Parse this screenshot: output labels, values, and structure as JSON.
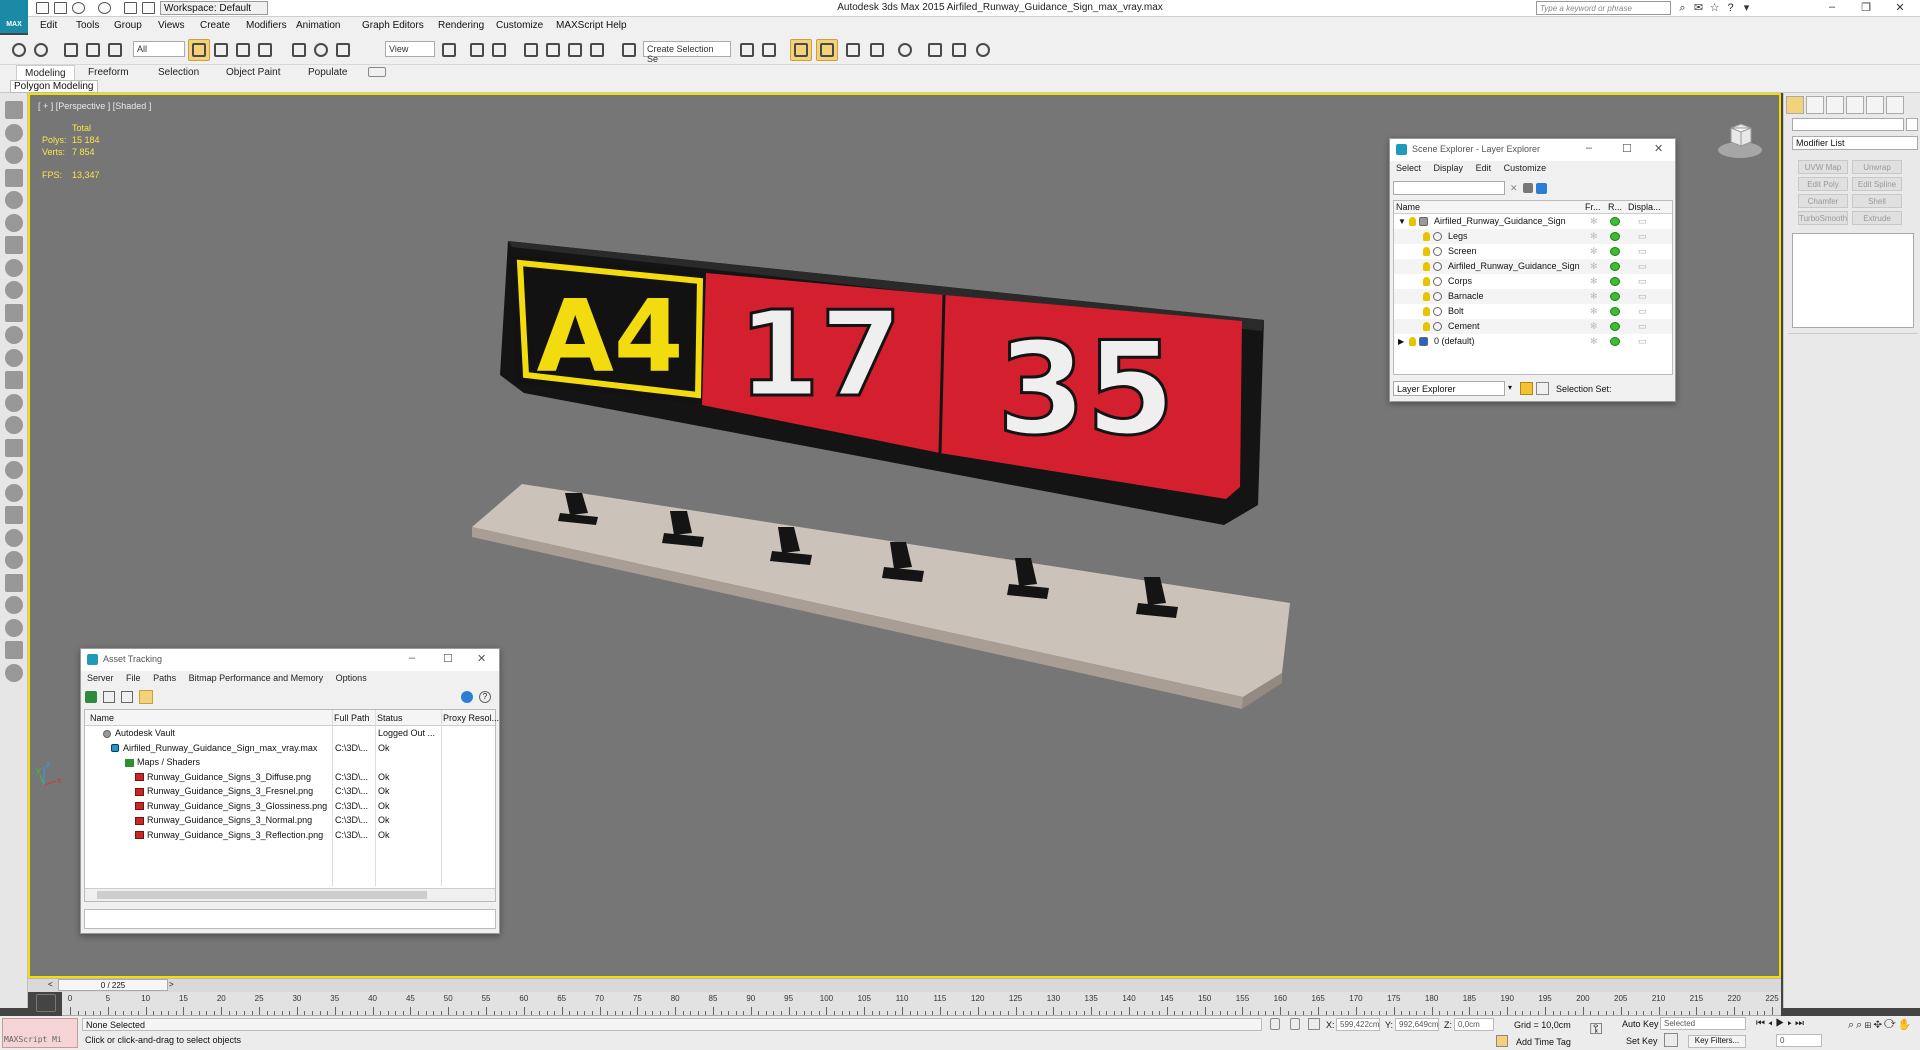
{
  "app": {
    "title": "Autodesk 3ds Max  2015     Airfiled_Runway_Guidance_Sign_max_vray.max",
    "logo_text": "MAX",
    "workspace": "Workspace: Default",
    "search_placeholder": "Type a keyword or phrase"
  },
  "menus": [
    "Edit",
    "Tools",
    "Group",
    "Views",
    "Create",
    "Modifiers",
    "Animation",
    "Graph Editors",
    "Rendering",
    "Customize",
    "MAXScript",
    "Help"
  ],
  "toolbar": {
    "selection_filter": "All",
    "ref_coord": "View",
    "named_selection_placeholder": "Create Selection Se"
  },
  "ribbon": {
    "tabs": [
      "Modeling",
      "Freeform",
      "Selection",
      "Object Paint",
      "Populate"
    ],
    "active_tab": "Modeling",
    "panel_label": "Polygon Modeling"
  },
  "viewport": {
    "label": "[ + ] [Perspective ] [Shaded ]",
    "stats": {
      "total_label": "Total",
      "polys_label": "Polys:",
      "polys_value": "15 184",
      "verts_label": "Verts:",
      "verts_value": "7 854",
      "fps_label": "FPS:",
      "fps_value": "13,347"
    },
    "sign": {
      "location": "A4",
      "runway_left": "17",
      "runway_right": "35",
      "colors": {
        "red": "#d41f2f",
        "yellow": "#f2dc0f",
        "black": "#141414",
        "base": "#c9bfb6"
      }
    },
    "axis": {
      "x": "x",
      "y": "y",
      "z": "z"
    }
  },
  "scene_explorer": {
    "title": "Scene Explorer - Layer Explorer",
    "menus": [
      "Select",
      "Display",
      "Edit",
      "Customize"
    ],
    "columns": [
      "Name",
      "Fr...",
      "R...",
      "Displa..."
    ],
    "rows": [
      {
        "name": "Airfiled_Runway_Guidance_Sign",
        "level": 0,
        "expanded": true
      },
      {
        "name": "Legs",
        "level": 1
      },
      {
        "name": "Screen",
        "level": 1
      },
      {
        "name": "Airfiled_Runway_Guidance_Sign",
        "level": 1
      },
      {
        "name": "Corps",
        "level": 1
      },
      {
        "name": "Barnacle",
        "level": 1
      },
      {
        "name": "Bolt",
        "level": 1
      },
      {
        "name": "Cement",
        "level": 1
      },
      {
        "name": "0 (default)",
        "level": 0,
        "expanded": false
      }
    ],
    "footer_dropdown": "Layer Explorer",
    "footer_label": "Selection Set:"
  },
  "asset_tracking": {
    "title": "Asset Tracking",
    "menus": [
      "Server",
      "File",
      "Paths",
      "Bitmap Performance and Memory",
      "Options"
    ],
    "columns": [
      "Name",
      "Full Path",
      "Status",
      "Proxy Resol..."
    ],
    "rows": [
      {
        "name": "Autodesk Vault",
        "path": "",
        "status": "Logged Out ...",
        "level": 0,
        "icon": "vault"
      },
      {
        "name": "Airfiled_Runway_Guidance_Sign_max_vray.max",
        "path": "C:\\3D\\...",
        "status": "Ok",
        "level": 1,
        "icon": "max"
      },
      {
        "name": "Maps / Shaders",
        "path": "",
        "status": "",
        "level": 2,
        "icon": "folder"
      },
      {
        "name": "Runway_Guidance_Signs_3_Diffuse.png",
        "path": "C:\\3D\\...",
        "status": "Ok",
        "level": 3,
        "icon": "file"
      },
      {
        "name": "Runway_Guidance_Signs_3_Fresnel.png",
        "path": "C:\\3D\\...",
        "status": "Ok",
        "level": 3,
        "icon": "file"
      },
      {
        "name": "Runway_Guidance_Signs_3_Glossiness.png",
        "path": "C:\\3D\\...",
        "status": "Ok",
        "level": 3,
        "icon": "file"
      },
      {
        "name": "Runway_Guidance_Signs_3_Normal.png",
        "path": "C:\\3D\\...",
        "status": "Ok",
        "level": 3,
        "icon": "file"
      },
      {
        "name": "Runway_Guidance_Signs_3_Reflection.png",
        "path": "C:\\3D\\...",
        "status": "Ok",
        "level": 3,
        "icon": "file"
      }
    ]
  },
  "command_panel": {
    "modifier_list": "Modifier List",
    "buttons": [
      "UVW Map",
      "Unwrap UVW",
      "Edit Poly",
      "Edit Spline",
      "Chamfer",
      "Shell",
      "TurboSmooth",
      "Extrude"
    ]
  },
  "timeline": {
    "frame": "0 / 225",
    "ticks": [
      0,
      5,
      10,
      15,
      20,
      25,
      30,
      35,
      40,
      45,
      50,
      55,
      60,
      65,
      70,
      75,
      80,
      85,
      90,
      95,
      100,
      105,
      110,
      115,
      120,
      125,
      130,
      135,
      140,
      145,
      150,
      155,
      160,
      165,
      170,
      175,
      180,
      185,
      190,
      195,
      200,
      205,
      210,
      215,
      220,
      225
    ],
    "end": 225
  },
  "status": {
    "maxscript": "MAXScript Mi",
    "selection": "None Selected",
    "prompt": "Click or click-and-drag to select objects",
    "x_label": "X:",
    "x_value": "599,422cm",
    "y_label": "Y:",
    "y_value": "992,649cm",
    "z_label": "Z:",
    "z_value": "0,0cm",
    "grid": "Grid = 10,0cm",
    "add_time_tag": "Add Time Tag",
    "auto_key": "Auto Key",
    "set_key": "Set Key",
    "key_mode": "Selected",
    "key_filters": "Key Filters...",
    "current_frame": "0"
  }
}
